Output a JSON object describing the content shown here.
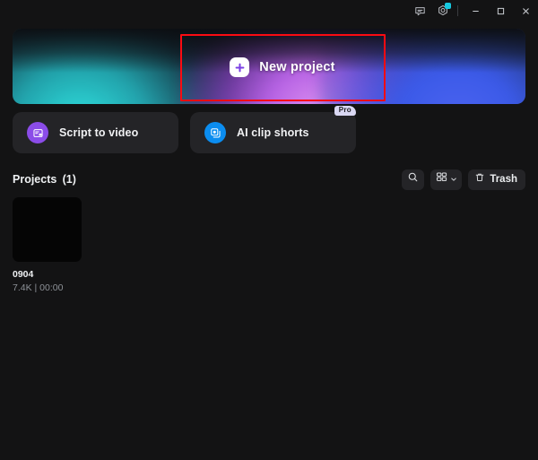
{
  "titlebar": {
    "feedback_icon": "chat-bubble-icon",
    "settings_icon": "gear-icon",
    "has_notification_dot": true,
    "notification_color": "#16c8e0",
    "minimize_label": "–",
    "maximize_label": "□",
    "close_label": "✕"
  },
  "hero": {
    "new_project_label": "New project",
    "plus_icon": "plus-icon",
    "highlight_color": "#fb0b12",
    "gradient_left": "#2fe2e0",
    "gradient_mid": "#b662e4",
    "gradient_right": "#4b63f0"
  },
  "cards": [
    {
      "label": "Script to video",
      "icon": "script-to-video-icon",
      "icon_color": "#8b4ce8",
      "badge": ""
    },
    {
      "label": "AI clip shorts",
      "icon": "ai-clip-shorts-icon",
      "icon_color": "#0b8df0",
      "badge": "Pro"
    }
  ],
  "projects_section": {
    "title": "Projects (1)",
    "search_icon": "search-icon",
    "view_icon": "grid-view-icon",
    "view_chevron": "chevron-down-icon",
    "trash_label": "Trash",
    "trash_icon": "trash-icon"
  },
  "projects": [
    {
      "name": "0904",
      "meta": "7.4K | 00:00"
    }
  ]
}
